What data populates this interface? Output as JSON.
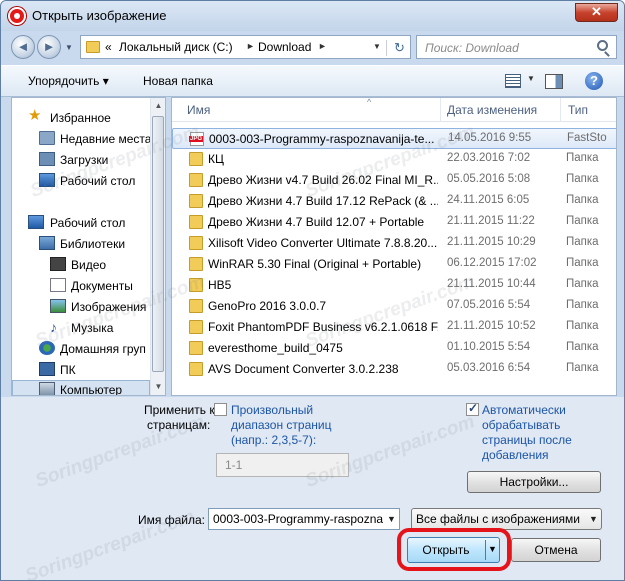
{
  "window": {
    "title": "Открыть изображение",
    "close_glyph": "✕"
  },
  "navbar": {
    "back_glyph": "◄",
    "forward_glyph": "►",
    "recent_glyph": "▼",
    "address": {
      "prefix": "«",
      "segments": [
        "Локальный диск (C:)",
        "Download"
      ],
      "arrow_glyph": "►",
      "dropdown_glyph": "▼"
    },
    "refresh_glyph": "↻",
    "search_placeholder": "Поиск: Download"
  },
  "toolbar": {
    "organize_label": "Упорядочить ▾",
    "new_folder_label": "Новая папка",
    "view_dropdown_glyph": "▼",
    "help_glyph": "?"
  },
  "nav_pane": {
    "items": [
      {
        "label": "Избранное",
        "icon": "star-icon"
      },
      {
        "label": "Недавние места",
        "icon": "recent-places-icon"
      },
      {
        "label": "Загрузки",
        "icon": "downloads-folder-icon"
      },
      {
        "label": "Рабочий стол",
        "icon": "desktop-icon"
      },
      {
        "label": "Рабочий стол",
        "icon": "desktop-icon"
      },
      {
        "label": "Библиотеки",
        "icon": "libraries-icon"
      },
      {
        "label": "Видео",
        "icon": "video-library-icon"
      },
      {
        "label": "Документы",
        "icon": "documents-library-icon"
      },
      {
        "label": "Изображения",
        "icon": "pictures-library-icon"
      },
      {
        "label": "Музыка",
        "icon": "music-library-icon"
      },
      {
        "label": "Домашняя груп",
        "icon": "homegroup-icon"
      },
      {
        "label": "ПК",
        "icon": "network-icon"
      },
      {
        "label": "Компьютер",
        "icon": "computer-icon"
      }
    ],
    "scroll_up_glyph": "▲",
    "scroll_down_glyph": "▼"
  },
  "file_pane": {
    "columns": [
      "Имя",
      "Дата изменения",
      "Тип"
    ],
    "sort_glyph": "^",
    "rows": [
      {
        "name": "0003-003-Programmy-raspoznavanija-te...",
        "date": "14.05.2016 9:55",
        "type": "FastSto",
        "kind": "jpg",
        "selected": true
      },
      {
        "name": "КЦ",
        "date": "22.03.2016 7:02",
        "type": "Папка",
        "kind": "folder"
      },
      {
        "name": "Древо Жизни v4.7 Build 26.02 Final MI_R...",
        "date": "05.05.2016 5:08",
        "type": "Папка",
        "kind": "folder"
      },
      {
        "name": "Древо Жизни 4.7 Build 17.12 RePack (& ...",
        "date": "24.11.2015 6:05",
        "type": "Папка",
        "kind": "folder"
      },
      {
        "name": "Древо Жизни 4.7 Build 12.07 + Portable",
        "date": "21.11.2015 11:22",
        "type": "Папка",
        "kind": "folder"
      },
      {
        "name": "Xilisoft Video Converter Ultimate 7.8.8.20...",
        "date": "21.11.2015 10:29",
        "type": "Папка",
        "kind": "folder"
      },
      {
        "name": "WinRAR 5.30 Final (Original + Portable)",
        "date": "06.12.2015 17:02",
        "type": "Папка",
        "kind": "folder"
      },
      {
        "name": "HB5",
        "date": "21.11.2015 10:44",
        "type": "Папка",
        "kind": "folder"
      },
      {
        "name": "GenoPro 2016 3.0.0.7",
        "date": "07.05.2016 5:54",
        "type": "Папка",
        "kind": "folder"
      },
      {
        "name": "Foxit PhantomPDF Business v6.2.1.0618 F...",
        "date": "21.11.2015 10:52",
        "type": "Папка",
        "kind": "folder"
      },
      {
        "name": "everesthome_build_0475",
        "date": "01.10.2015 5:54",
        "type": "Папка",
        "kind": "folder"
      },
      {
        "name": "AVS Document Converter 3.0.2.238",
        "date": "05.03.2016 6:54",
        "type": "Папка",
        "kind": "folder"
      }
    ],
    "scroll_up_glyph": "▲",
    "scroll_down_glyph": "▼"
  },
  "options": {
    "apply_label_line1": "Применить к",
    "apply_label_line2": "страницам:",
    "custom_range_line1": "Произвольный",
    "custom_range_line2": "диапазон страниц",
    "custom_range_line3": "(напр.: 2,3,5-7):",
    "custom_range_checked": false,
    "range_value": "1-1",
    "auto_process_line1": "Автоматически",
    "auto_process_line2": "обрабатывать",
    "auto_process_line3": "страницы после",
    "auto_process_line4": "добавления",
    "auto_process_checked": true,
    "settings_button": "Настройки..."
  },
  "footer": {
    "filename_label": "Имя файла:",
    "filename_value": "0003-003-Programmy-raspozna",
    "filename_dropdown_glyph": "▼",
    "filter_value": "Все файлы с изображениями",
    "filter_dropdown_glyph": "▼",
    "open_button": "Открыть",
    "open_dropdown_glyph": "▼",
    "cancel_button": "Отмена"
  },
  "watermark_text": "Soringpcrepair.com",
  "colors": {
    "accent_ring": "#e4141a",
    "link": "#1d55a6",
    "window_frame": "#c9daee"
  }
}
